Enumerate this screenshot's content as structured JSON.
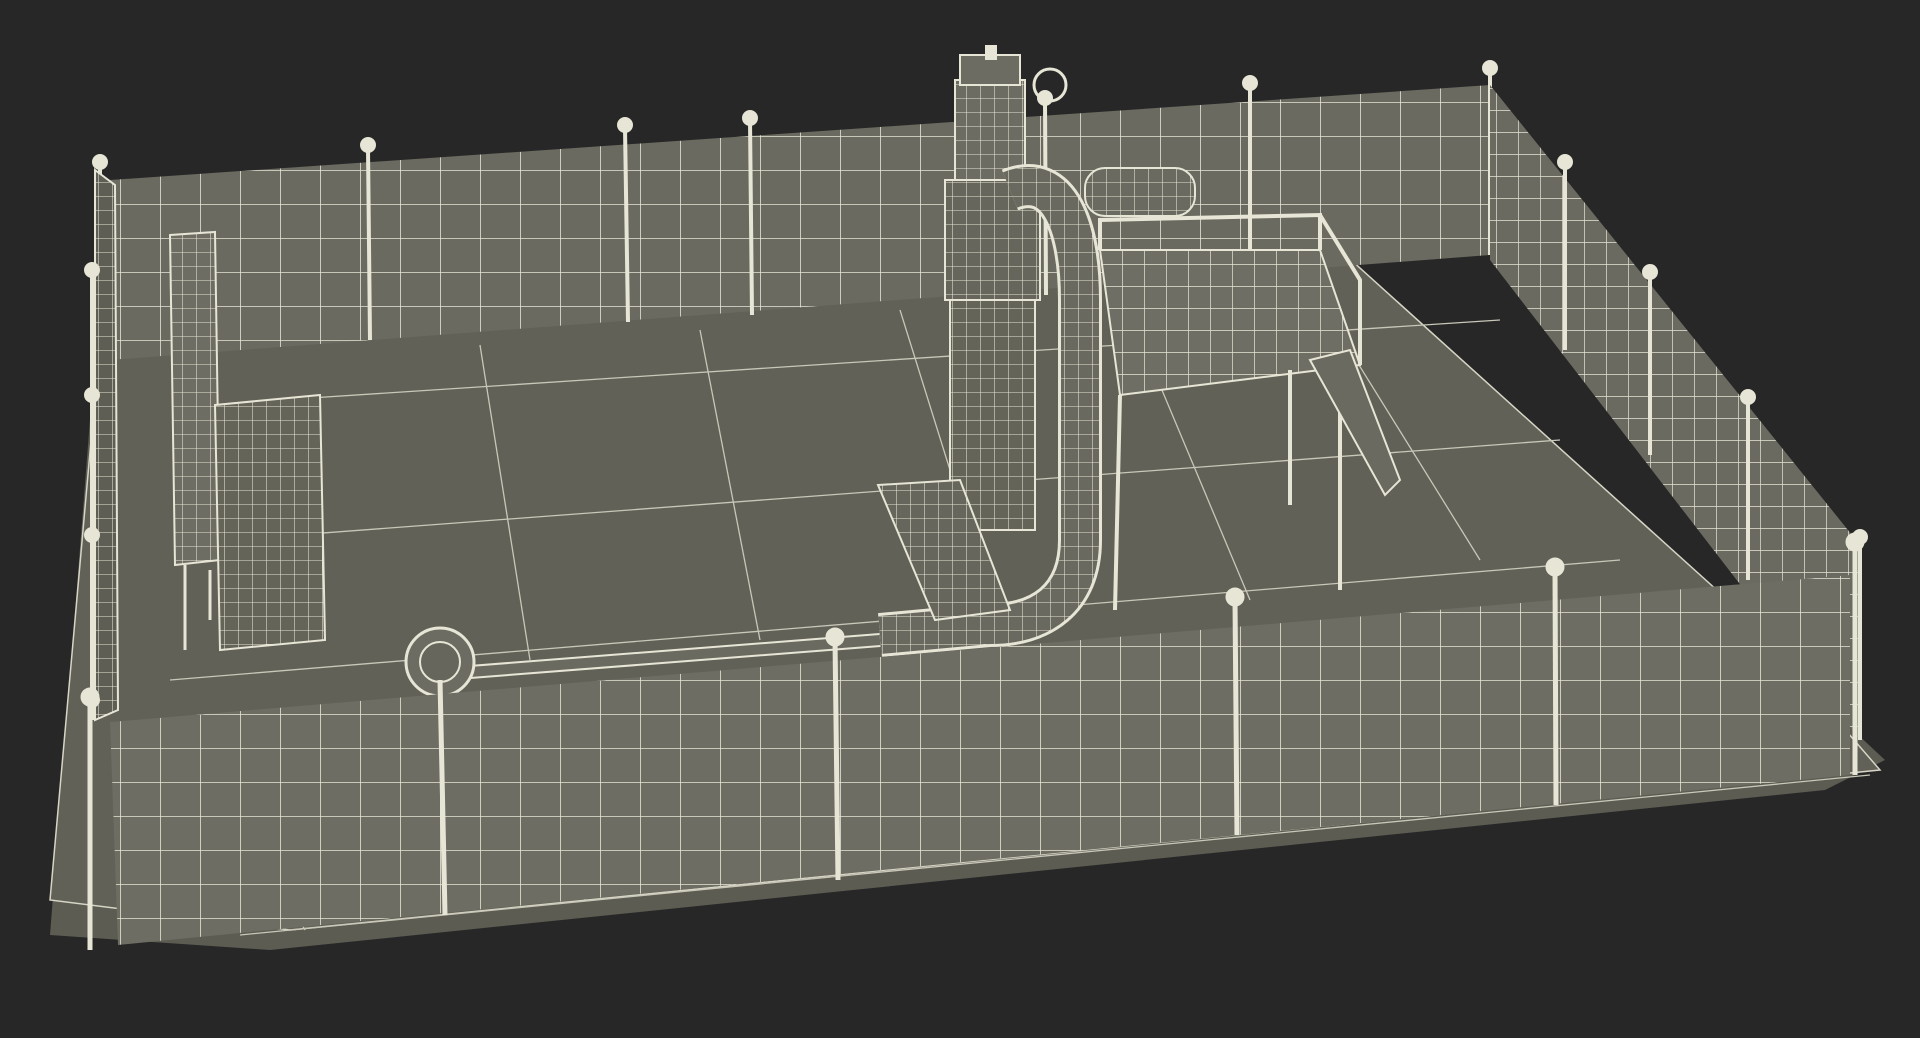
{
  "render": {
    "subject": "wireframe-oil-wellhead-facility",
    "style": "3d-wireframe-render",
    "colors": {
      "background": "#272727",
      "ground_fill": "#616157",
      "ground_shade": "#55554c",
      "panel_fill": "#6b6b61",
      "panel_dark": "#5e5e55",
      "wire": "#e7e5d5",
      "wire_dim": "#c9c7b8"
    }
  }
}
